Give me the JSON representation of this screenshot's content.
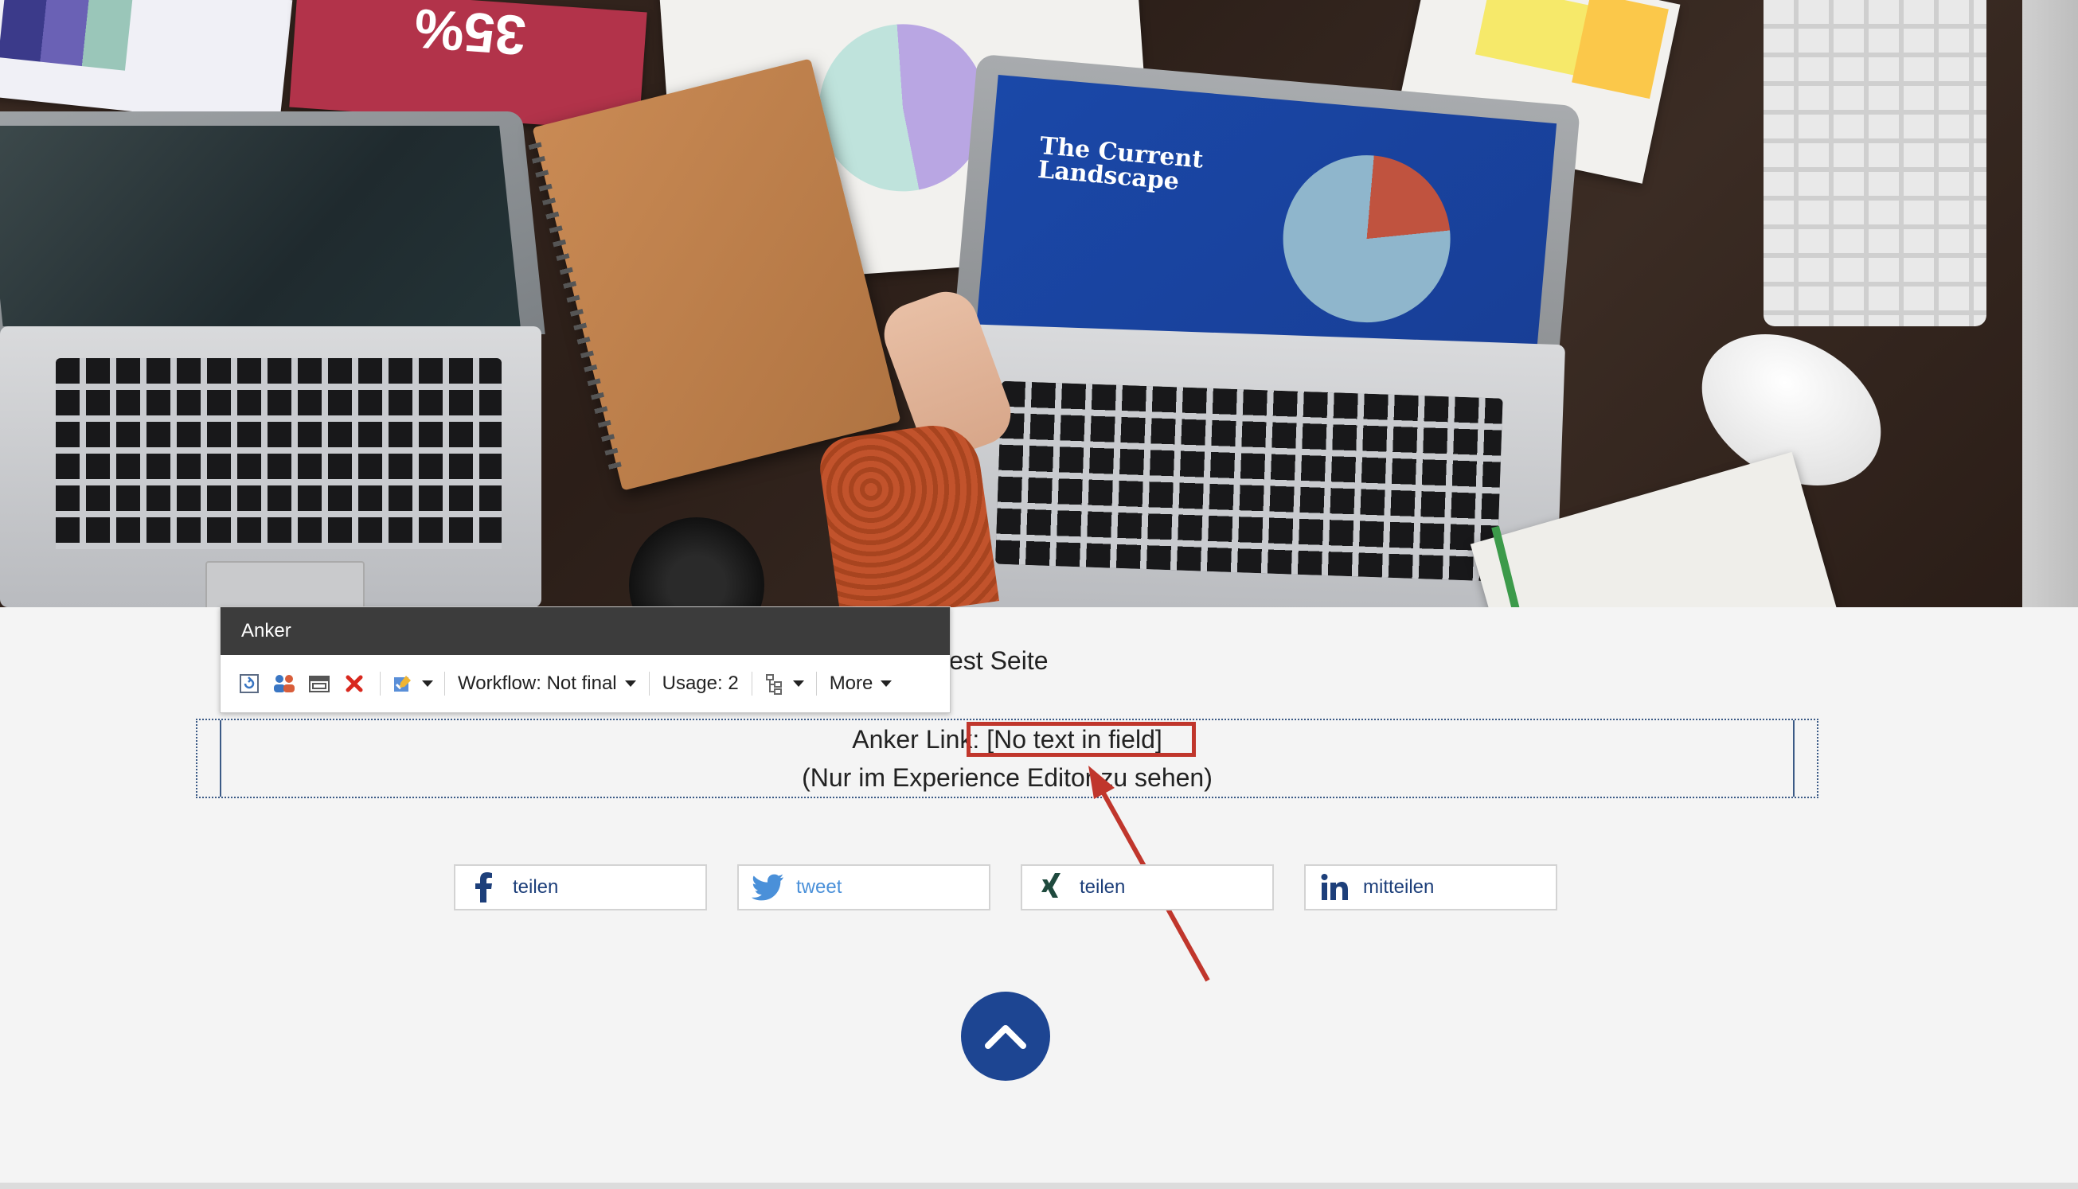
{
  "hero": {
    "screen_title": "The Current\nLandscape",
    "card_text": "35%"
  },
  "chrome": {
    "header_title": "Anker",
    "workflow_label": "Workflow: Not final",
    "usage_label": "Usage: 2",
    "more_label": "More"
  },
  "page": {
    "heading_partial": "est Seite"
  },
  "anchor": {
    "line1_prefix": "Anker Link: ",
    "line1_value": "[No text in field]",
    "line2": "(Nur im Experience Editor zu sehen)"
  },
  "share": {
    "facebook_label": "teilen",
    "twitter_label": "tweet",
    "xing_label": "teilen",
    "linkedin_label": "mitteilen"
  },
  "colors": {
    "annotation": "#c0362c",
    "brand_blue": "#1d4592",
    "twitter_blue": "#4a90d9",
    "xing_green": "#1f4a3e"
  }
}
